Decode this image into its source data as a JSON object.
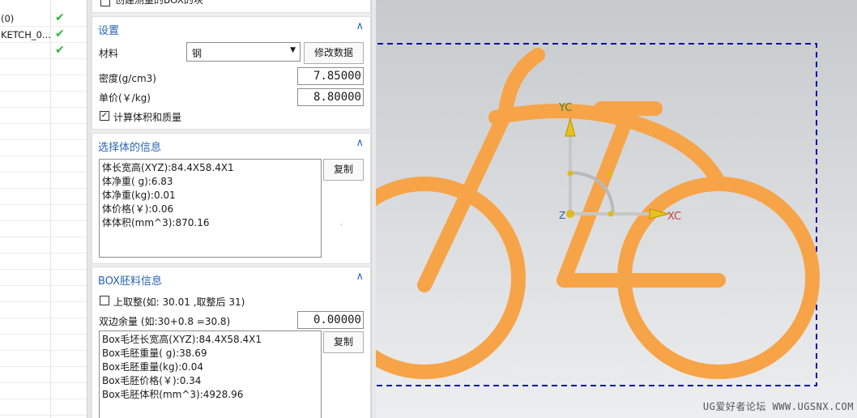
{
  "tree": {
    "rows": [
      {
        "text": "(0)",
        "check": true
      },
      {
        "text": "KETCH_0...",
        "check": true
      },
      {
        "text": "",
        "check": true
      }
    ]
  },
  "top_option": {
    "label": "创建测量的BOX的块"
  },
  "settings": {
    "header": "设置",
    "material_label": "材料",
    "material_value": "钢",
    "modify_button": "修改数据",
    "density_label": "密度(g/cm3)",
    "density_value": "7.85000",
    "price_label": "单价(￥/kg)",
    "price_value": "8.80000",
    "calc_label": "计算体积和质量",
    "calc_checked": true
  },
  "body_info": {
    "header": "选择体的信息",
    "lines": "体长宽高(XYZ):84.4X58.4X1\n体净重( g):6.83\n体净重(kg):0.01\n体价格(￥):0.06\n体体积(mm^3):870.16",
    "copy_button": "复制"
  },
  "box_info": {
    "header": "BOX胚料信息",
    "round_label": "上取整(如: 30.01 ,取整后 31)",
    "round_checked": false,
    "margin_label": "双边余量 (如:30+0.8 =30.8)",
    "margin_value": "0.00000",
    "lines": "Box毛坯长宽高(XYZ):84.4X58.4X1\nBox毛胚重量( g):38.69\nBox毛胚重量(kg):0.04\nBox毛胚价格(￥):0.34\nBox毛胚体积(mm^3):4928.96",
    "copy_button": "复制"
  },
  "viewport": {
    "axis_y": "YC",
    "axis_x": "XC",
    "axis_z": "Z",
    "watermark": "UG爱好者论坛 WWW.UGSNX.COM",
    "colors": {
      "bike": "#f7a347",
      "box": "#1010a8",
      "yaxis": "#3a8a3a",
      "xaxis": "#c84040"
    }
  }
}
